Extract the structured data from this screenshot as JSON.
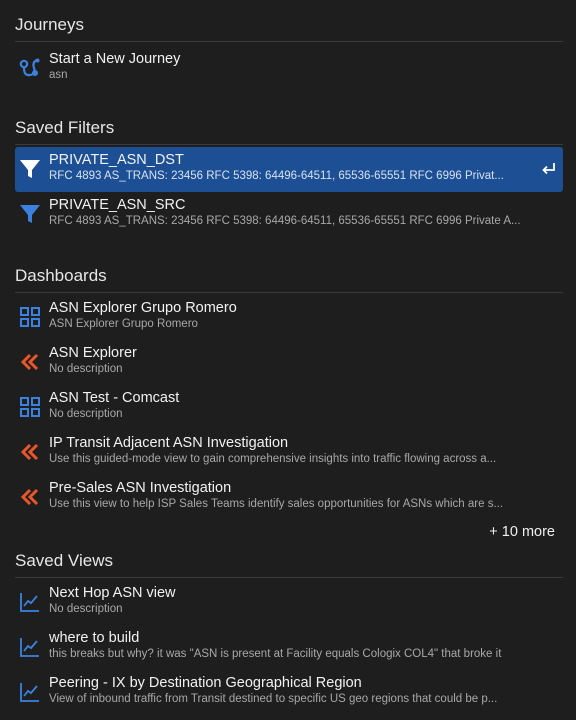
{
  "journeys": {
    "title": "Journeys",
    "items": [
      {
        "title": "Start a New Journey",
        "desc": "asn",
        "icon": "journey-icon"
      }
    ]
  },
  "saved_filters": {
    "title": "Saved Filters",
    "items": [
      {
        "title": "PRIVATE_ASN_DST",
        "desc": "RFC 4893 AS_TRANS: 23456 RFC 5398: 64496-64511, 65536-65551 RFC 6996 Privat...",
        "icon": "filter-icon",
        "selected": true
      },
      {
        "title": "PRIVATE_ASN_SRC",
        "desc": "RFC 4893 AS_TRANS: 23456 RFC 5398: 64496-64511, 65536-65551 RFC 6996 Private A...",
        "icon": "filter-icon"
      }
    ]
  },
  "dashboards": {
    "title": "Dashboards",
    "items": [
      {
        "title": "ASN Explorer Grupo Romero",
        "desc": "ASN Explorer Grupo Romero",
        "icon": "dashboard-grid-icon"
      },
      {
        "title": "ASN Explorer",
        "desc": "No description",
        "icon": "guided-chevrons-icon"
      },
      {
        "title": "ASN Test - Comcast",
        "desc": "No description",
        "icon": "dashboard-grid-icon"
      },
      {
        "title": "IP Transit Adjacent ASN Investigation",
        "desc": "Use this guided-mode view to gain comprehensive insights into traffic flowing across a...",
        "icon": "guided-chevrons-icon"
      },
      {
        "title": "Pre-Sales ASN Investigation",
        "desc": "Use this view to help ISP Sales Teams identify sales opportunities for ASNs which are s...",
        "icon": "guided-chevrons-icon"
      }
    ],
    "more_label": "+ 10 more"
  },
  "saved_views": {
    "title": "Saved Views",
    "items": [
      {
        "title": "Next Hop ASN view",
        "desc": "No description",
        "icon": "line-chart-icon"
      },
      {
        "title": "where to build",
        "desc": "this breaks but why? it was \"ASN is present at Facility equals Cologix COL4\" that broke it",
        "icon": "line-chart-icon"
      },
      {
        "title": "Peering - IX by Destination Geographical Region",
        "desc": "View of inbound traffic from Transit destined to specific US geo regions that could be p...",
        "icon": "line-chart-icon"
      }
    ]
  },
  "colors": {
    "accent_blue": "#3b82e0",
    "accent_orange": "#e8562a",
    "selected_bg": "#1c4f94"
  }
}
